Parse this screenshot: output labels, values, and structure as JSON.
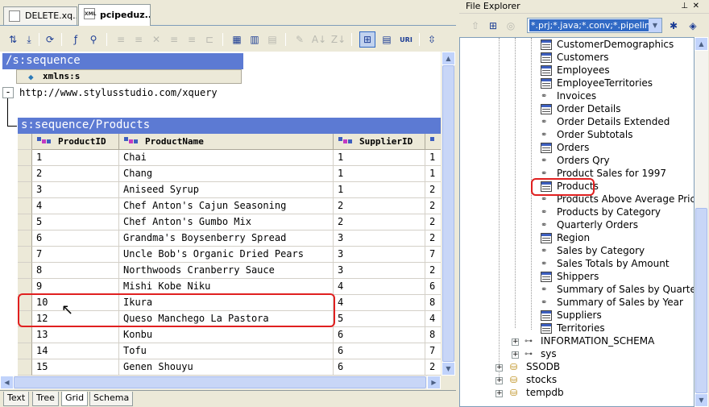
{
  "tabs": [
    {
      "label": "DELETE.xq...",
      "active": false
    },
    {
      "label": "pcipeduz...",
      "active": true
    }
  ],
  "left": {
    "sequence_header": "/s:sequence",
    "attribute_column": "xmlns:s",
    "attribute_value": "http://www.stylusstudio.com/xquery",
    "expand_toggle": "-",
    "products_header": "s:sequence/Products",
    "columns": [
      "ProductID",
      "ProductName",
      "SupplierID"
    ],
    "rows": [
      [
        "1",
        "Chai",
        "1",
        "1"
      ],
      [
        "2",
        "Chang",
        "1",
        "1"
      ],
      [
        "3",
        "Aniseed Syrup",
        "1",
        "2"
      ],
      [
        "4",
        "Chef Anton's Cajun Seasoning",
        "2",
        "2"
      ],
      [
        "5",
        "Chef Anton's Gumbo Mix",
        "2",
        "2"
      ],
      [
        "6",
        "Grandma's Boysenberry Spread",
        "3",
        "2"
      ],
      [
        "7",
        "Uncle Bob's Organic Dried Pears",
        "3",
        "7"
      ],
      [
        "8",
        "Northwoods Cranberry Sauce",
        "3",
        "2"
      ],
      [
        "9",
        "Mishi Kobe Niku",
        "4",
        "6"
      ],
      [
        "10",
        "Ikura",
        "4",
        "8"
      ],
      [
        "12",
        "Queso Manchego La Pastora",
        "5",
        "4"
      ],
      [
        "13",
        "Konbu",
        "6",
        "8"
      ],
      [
        "14",
        "Tofu",
        "6",
        "7"
      ],
      [
        "15",
        "Genen Shouyu",
        "6",
        "2"
      ]
    ],
    "bottom_tabs": [
      "Text",
      "Tree",
      "Grid",
      "Schema"
    ],
    "active_bottom_tab": "Grid"
  },
  "explorer": {
    "title": "File Explorer",
    "filter_value": "*.prj;*.java;*.conv;*.pipeline;*.re",
    "items": [
      {
        "label": "CustomerDemographics",
        "type": "table"
      },
      {
        "label": "Customers",
        "type": "table"
      },
      {
        "label": "Employees",
        "type": "table"
      },
      {
        "label": "EmployeeTerritories",
        "type": "table"
      },
      {
        "label": "Invoices",
        "type": "view"
      },
      {
        "label": "Order Details",
        "type": "table"
      },
      {
        "label": "Order Details Extended",
        "type": "view"
      },
      {
        "label": "Order Subtotals",
        "type": "view"
      },
      {
        "label": "Orders",
        "type": "table"
      },
      {
        "label": "Orders Qry",
        "type": "view"
      },
      {
        "label": "Product Sales for 1997",
        "type": "view"
      },
      {
        "label": "Products",
        "type": "table"
      },
      {
        "label": "Products Above Average Price",
        "type": "view"
      },
      {
        "label": "Products by Category",
        "type": "view"
      },
      {
        "label": "Quarterly Orders",
        "type": "view"
      },
      {
        "label": "Region",
        "type": "table"
      },
      {
        "label": "Sales by Category",
        "type": "view"
      },
      {
        "label": "Sales Totals by Amount",
        "type": "view"
      },
      {
        "label": "Shippers",
        "type": "table"
      },
      {
        "label": "Summary of Sales by Quarter",
        "type": "view"
      },
      {
        "label": "Summary of Sales by Year",
        "type": "view"
      },
      {
        "label": "Suppliers",
        "type": "table"
      },
      {
        "label": "Territories",
        "type": "table"
      }
    ],
    "schemas": [
      {
        "label": "INFORMATION_SCHEMA"
      },
      {
        "label": "sys"
      }
    ],
    "databases": [
      {
        "label": "SSODB"
      },
      {
        "label": "stocks"
      },
      {
        "label": "tempdb"
      }
    ]
  },
  "colors": {
    "header_blue": "#5c7ad3",
    "selection_blue": "#316ac5",
    "highlight_red": "#e02020"
  }
}
